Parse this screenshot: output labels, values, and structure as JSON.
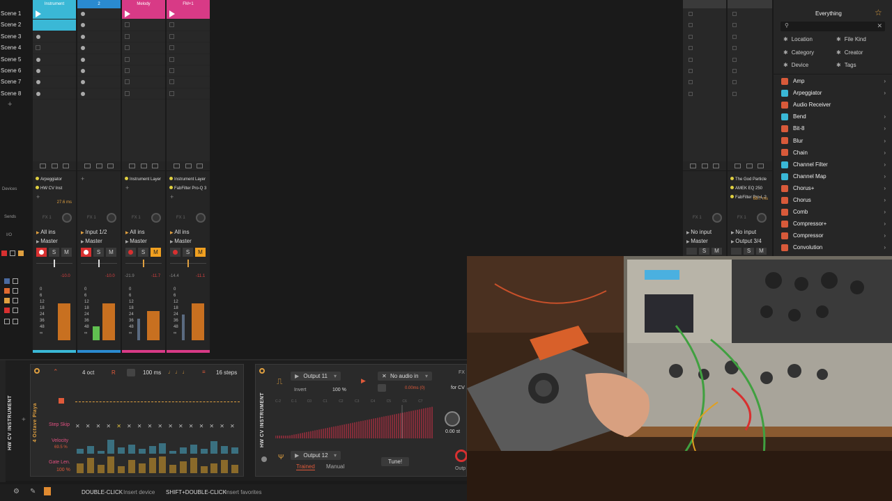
{
  "scenes": [
    "Scene 1",
    "Scene 2",
    "Scene 3",
    "Scene 4",
    "Scene 5",
    "Scene 6",
    "Scene 7",
    "Scene 8"
  ],
  "tracks": [
    {
      "head": "Instrument",
      "color": "#3ab8d6",
      "devices": [
        "Arpeggiator",
        "HW CV Inst"
      ],
      "latency": "27.6 ms",
      "fx": "FX 1",
      "io_in": "All ins",
      "io_out": "Master",
      "vol": "-10.0",
      "vol2": ""
    },
    {
      "head": "2",
      "color": "#2a8ad0",
      "devices": [],
      "latency": "",
      "fx": "FX 1",
      "io_in": "Input 1/2",
      "io_out": "Master",
      "vol": "-10.0",
      "vol2": ""
    },
    {
      "head": "Melody",
      "color": "#d83a86",
      "devices": [
        "Instrument Layer"
      ],
      "latency": "",
      "fx": "FX 1",
      "io_in": "All ins",
      "io_out": "Master",
      "vol": "-21.9",
      "vol2": "-11.7"
    },
    {
      "head": "FM+1",
      "color": "#d83a86",
      "devices": [
        "Instrument Layer",
        "FabFilter Pro-Q 3"
      ],
      "latency": "",
      "fx": "FX 1",
      "io_in": "All ins",
      "io_out": "Master",
      "vol": "-14.4",
      "vol2": "-11.1"
    }
  ],
  "right_tracks": [
    {
      "devices": [],
      "fx": "FX 1",
      "io_in": "No input",
      "io_out": "Master"
    },
    {
      "devices": [
        "The God Particle",
        "AMEK EQ 250",
        "FabFilter Pro-L 2"
      ],
      "latency": "68.7 ms",
      "fx": "FX 1",
      "io_in": "No input",
      "io_out": "Output 3/4"
    }
  ],
  "side_labels": {
    "devices": "Devices",
    "sends": "Sends",
    "io": "I/O"
  },
  "meter_scale": [
    "0",
    "6",
    "12",
    "18",
    "24",
    "36",
    "48",
    "∞"
  ],
  "buttons": {
    "s": "S",
    "m": "M"
  },
  "arp": {
    "octave": "4 oct",
    "r": "R",
    "rate": "100 ms",
    "steps": "16 steps",
    "step_skip": "Step Skip",
    "velocity": "Velocity",
    "velocity_val": "69.5 %",
    "gate_len": "Gate Len.",
    "gate_val": "100 %",
    "vertical_label": "4 Octave Playa",
    "device_name": "HW CV INSTRUMENT",
    "velocity_values": [
      0.3,
      0.5,
      0.2,
      0.9,
      0.4,
      0.6,
      0.3,
      0.5,
      0.7,
      0.2,
      0.4,
      0.6,
      0.3,
      0.8,
      0.5,
      0.4
    ],
    "gate_values": [
      0.6,
      0.9,
      0.5,
      1.0,
      0.4,
      0.8,
      0.6,
      0.9,
      1.0,
      0.5,
      0.7,
      0.9,
      0.4,
      0.6,
      0.8,
      0.5
    ]
  },
  "cv": {
    "device_name": "HW CV INSTRUMENT",
    "output1": "Output 11",
    "invert": "Invert",
    "invert_val": "100 %",
    "audio_in": "No audio in",
    "delay": "0.00ms (0)",
    "output2": "Output 12",
    "trained": "Trained",
    "manual": "Manual",
    "tune": "Tune!",
    "pitch": "0.00 st",
    "fx_label": "FX",
    "for_cv": "for CV",
    "outp": "Outp",
    "notes": [
      "C-2",
      "C-1",
      "C0",
      "C1",
      "C2",
      "C3",
      "C4",
      "C5",
      "C6",
      "C7"
    ]
  },
  "status": {
    "dbl_click": "DOUBLE-CLICK",
    "insert_device": "Insert device",
    "shift_dbl": "SHIFT+DOUBLE-CLICK",
    "insert_fav": "Insert favorites"
  },
  "browser": {
    "title": "Everything",
    "search_placeholder": "",
    "filters": [
      "Location",
      "File Kind",
      "Category",
      "Creator",
      "Device",
      "Tags"
    ],
    "items": [
      {
        "label": "Amp",
        "color": "#d85a3a",
        "chev": true
      },
      {
        "label": "Arpeggiator",
        "color": "#3ab8d6",
        "chev": true
      },
      {
        "label": "Audio Receiver",
        "color": "#d85a3a",
        "chev": false
      },
      {
        "label": "Bend",
        "color": "#3ab8d6",
        "chev": true
      },
      {
        "label": "Bit-8",
        "color": "#d85a3a",
        "chev": true
      },
      {
        "label": "Blur",
        "color": "#d85a3a",
        "chev": true
      },
      {
        "label": "Chain",
        "color": "#d85a3a",
        "chev": true
      },
      {
        "label": "Channel Filter",
        "color": "#3ab8d6",
        "chev": true
      },
      {
        "label": "Channel Map",
        "color": "#3ab8d6",
        "chev": true
      },
      {
        "label": "Chorus+",
        "color": "#d85a3a",
        "chev": true
      },
      {
        "label": "Chorus",
        "color": "#d85a3a",
        "chev": true
      },
      {
        "label": "Comb",
        "color": "#d85a3a",
        "chev": true
      },
      {
        "label": "Compressor+",
        "color": "#d85a3a",
        "chev": true
      },
      {
        "label": "Compressor",
        "color": "#d85a3a",
        "chev": true
      },
      {
        "label": "Convolution",
        "color": "#d85a3a",
        "chev": true
      }
    ]
  }
}
